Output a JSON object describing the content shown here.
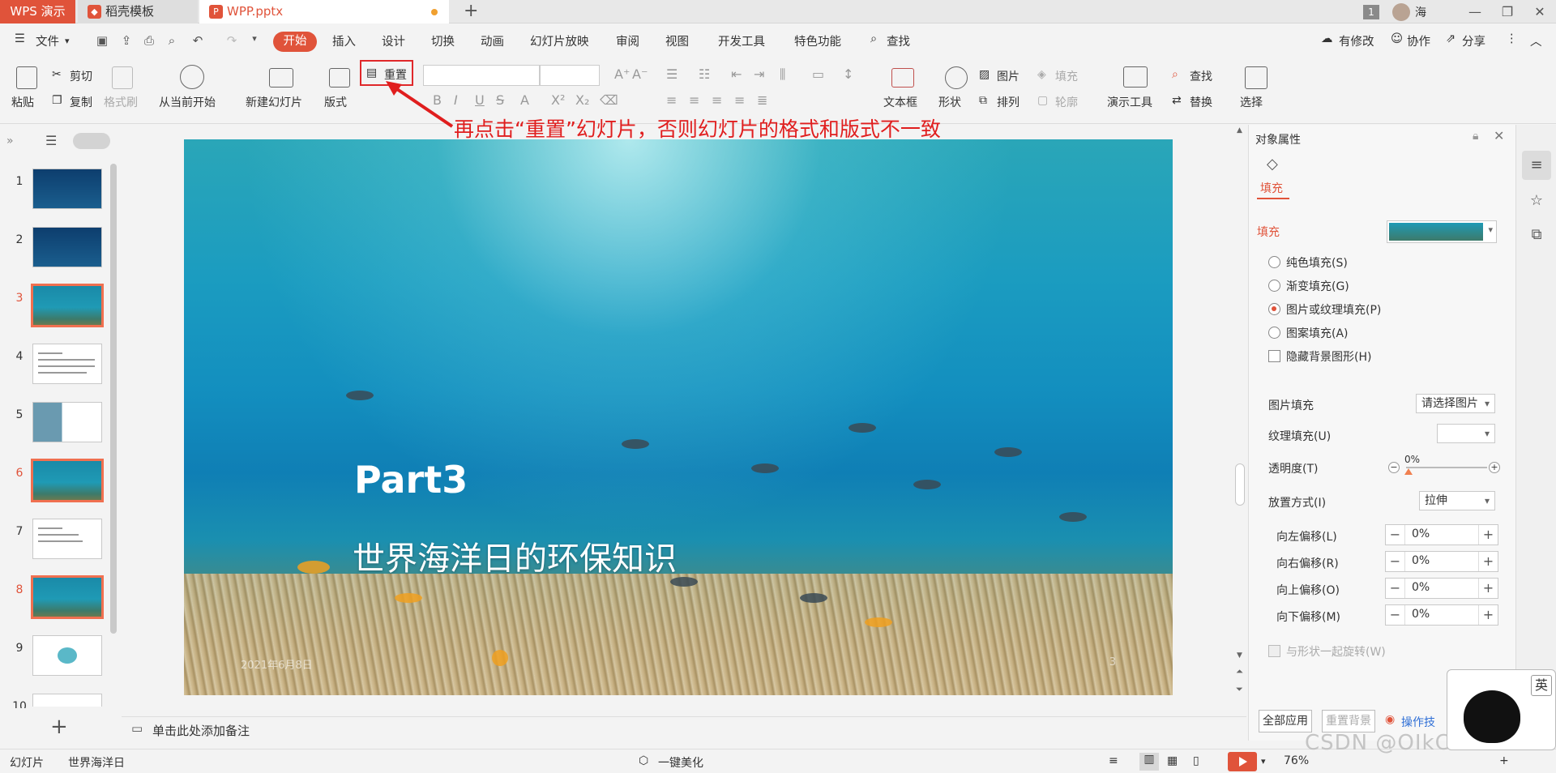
{
  "titlebar": {
    "app_tab": "WPS 演示",
    "template_tab": "稻壳模板",
    "doc_tab": "WPP.pptx",
    "new_tab": "+",
    "window_count": "1",
    "user_name": "海"
  },
  "menubar": {
    "file": "文件",
    "tabs": [
      "开始",
      "插入",
      "设计",
      "切换",
      "动画",
      "幻灯片放映",
      "审阅",
      "视图",
      "开发工具",
      "特色功能"
    ],
    "search": "查找",
    "has_changes": "有修改",
    "collaborate": "协作",
    "share": "分享"
  },
  "ribbon": {
    "paste": "粘贴",
    "cut": "剪切",
    "copy": "复制",
    "format_painter": "格式刷",
    "from_current": "从当前开始",
    "new_slide": "新建幻灯片",
    "layout": "版式",
    "reset": "重置",
    "textbox": "文本框",
    "shape": "形状",
    "picture": "图片",
    "fill": "填充",
    "arrange": "排列",
    "outline": "轮廓",
    "present_tools": "演示工具",
    "find": "查找",
    "replace": "替换",
    "select": "选择"
  },
  "annotation": "再点击“重置”幻灯片，否则幻灯片的格式和版式不一致",
  "slides": {
    "numbers": [
      "1",
      "2",
      "3",
      "4",
      "5",
      "6",
      "7",
      "8",
      "9",
      "10"
    ],
    "selected": [
      3,
      6,
      8
    ],
    "add": "+"
  },
  "slide": {
    "part": "Part3",
    "title": "世界海洋日的环保知识",
    "date": "2021年6月8日",
    "page": "3"
  },
  "notes_placeholder": "单击此处添加备注",
  "props": {
    "header": "对象属性",
    "tab_fill": "填充",
    "section_fill": "填充",
    "options": [
      {
        "label": "纯色填充(S)",
        "checked": false
      },
      {
        "label": "渐变填充(G)",
        "checked": false
      },
      {
        "label": "图片或纹理填充(P)",
        "checked": true
      },
      {
        "label": "图案填充(A)",
        "checked": false
      }
    ],
    "hide_bg": "隐藏背景图形(H)",
    "picture_fill_label": "图片填充",
    "picture_fill_value": "请选择图片",
    "texture_fill_label": "纹理填充(U)",
    "transparency_label": "透明度(T)",
    "transparency_value": "0%",
    "placement_label": "放置方式(I)",
    "placement_value": "拉伸",
    "offsets": [
      {
        "label": "向左偏移(L)",
        "value": "0%"
      },
      {
        "label": "向右偏移(R)",
        "value": "0%"
      },
      {
        "label": "向上偏移(O)",
        "value": "0%"
      },
      {
        "label": "向下偏移(M)",
        "value": "0%"
      }
    ],
    "rotate_with_shape": "与形状一起旋转(W)",
    "apply_all": "全部应用",
    "reset_bg": "重置背景",
    "tips": "操作技"
  },
  "statusbar": {
    "slide_label": "幻灯片",
    "theme": "世界海洋日",
    "beautify": "一键美化",
    "zoom": "76%"
  },
  "ime": "英",
  "watermark": "CSDN @OIkCorrect",
  "colors": {
    "accent": "#e0533a",
    "annotation": "#e01e1e"
  }
}
